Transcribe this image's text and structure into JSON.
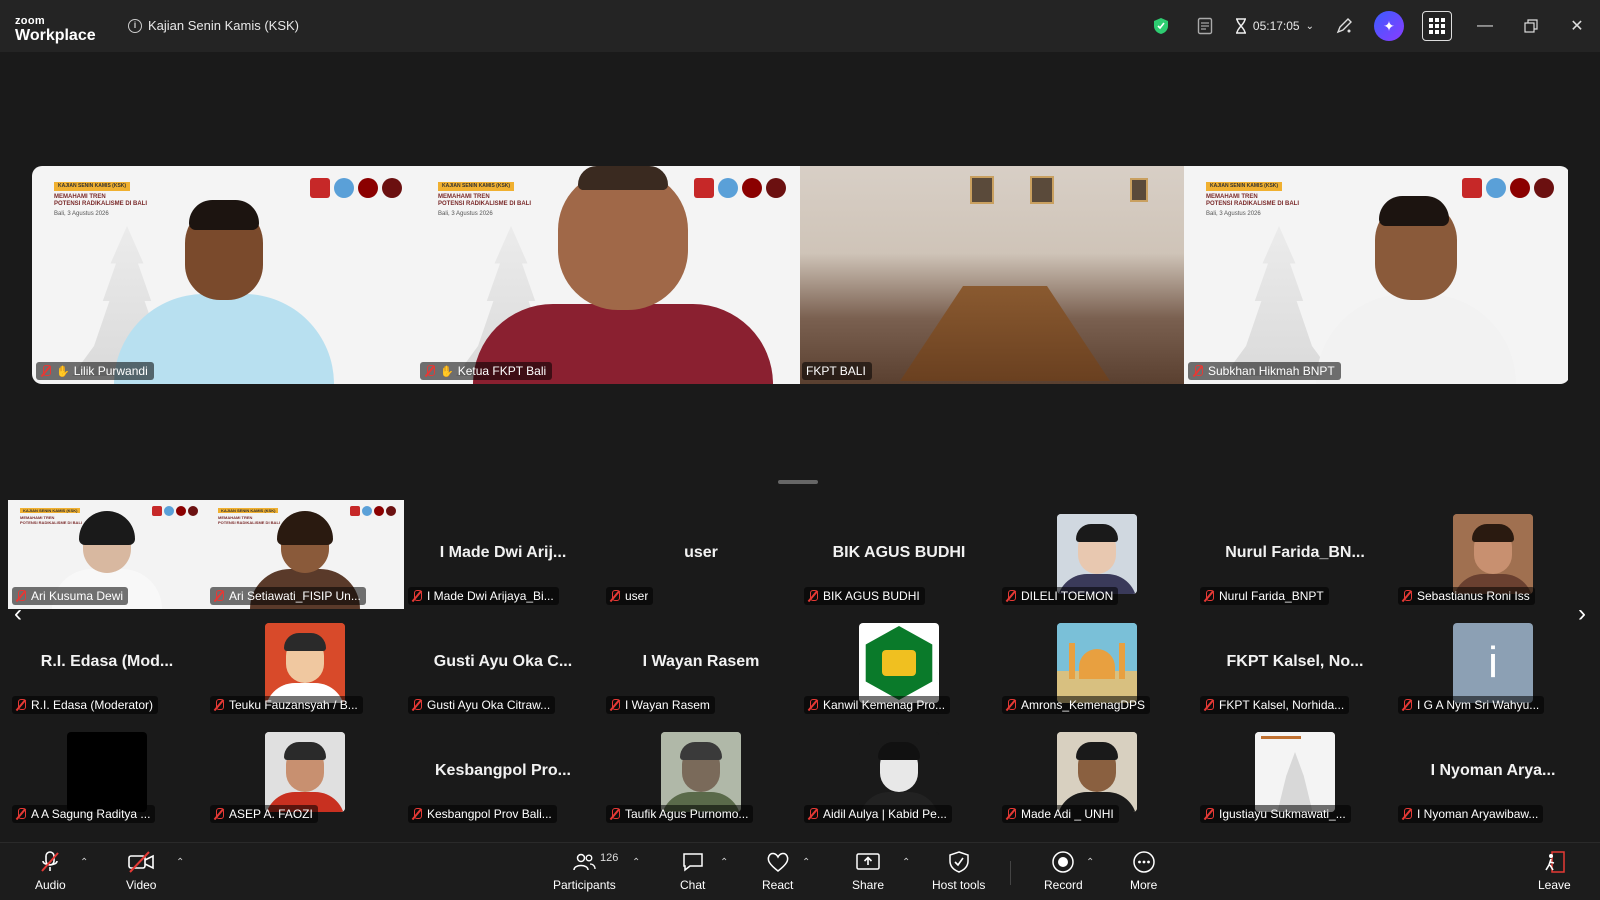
{
  "app": {
    "logo_line1": "zoom",
    "logo_line2": "Workplace",
    "meeting_title": "Kajian Senin Kamis (KSK)",
    "timer": "05:17:05"
  },
  "slide": {
    "tag": "KAJIAN SENIN KAMIS (KSK)",
    "title_line1": "MEMAHAMI TREN",
    "title_line2": "POTENSI RADIKALISME DI BALI",
    "date": "Bali, 3 Agustus 2026"
  },
  "speakers": [
    {
      "name": "Lilik Purwandi"
    },
    {
      "name": "Ketua FKPT Bali"
    },
    {
      "name": "FKPT BALI"
    },
    {
      "name": "Subkhan Hikmah BNPT"
    }
  ],
  "gallery": {
    "row1": [
      {
        "label": "Ari Kusuma Dewi",
        "big": ""
      },
      {
        "label": "Ari Setiawati_FISIP Un...",
        "big": ""
      },
      {
        "label": "I Made Dwi Arijaya_Bi...",
        "big": "I Made Dwi Arij..."
      },
      {
        "label": "user",
        "big": "user"
      },
      {
        "label": "BIK AGUS BUDHI",
        "big": "BIK AGUS BUDHI"
      },
      {
        "label": "DILELI TOEMON",
        "big": ""
      },
      {
        "label": "Nurul Farida_BNPT",
        "big": "Nurul Farida_BN..."
      },
      {
        "label": "Sebastianus Roni Iss",
        "big": ""
      }
    ],
    "row2": [
      {
        "label": "R.I. Edasa (Moderator)",
        "big": "R.I. Edasa (Mod..."
      },
      {
        "label": "Teuku Fauzansyah / B...",
        "big": ""
      },
      {
        "label": "Gusti Ayu Oka Citraw...",
        "big": "Gusti Ayu Oka C..."
      },
      {
        "label": "I Wayan Rasem",
        "big": "I Wayan Rasem"
      },
      {
        "label": "Kanwil Kemenag Pro...",
        "big": ""
      },
      {
        "label": "Amrons_KemenagDPS",
        "big": ""
      },
      {
        "label": "FKPT Kalsel, Norhida...",
        "big": "FKPT Kalsel, No..."
      },
      {
        "label": "I G A Nym Sri Wahyu...",
        "big": ""
      }
    ],
    "row3": [
      {
        "label": "A A Sagung Raditya ...",
        "big": ""
      },
      {
        "label": "ASEP A. FAOZI",
        "big": ""
      },
      {
        "label": "Kesbangpol Prov Bali...",
        "big": "Kesbangpol Pro..."
      },
      {
        "label": "Taufik Agus Purnomo...",
        "big": ""
      },
      {
        "label": "Aidil Aulya | Kabid Pe...",
        "big": ""
      },
      {
        "label": "Made Adi _ UNHI",
        "big": ""
      },
      {
        "label": "Igustiayu Sukmawati_...",
        "big": ""
      },
      {
        "label": "I Nyoman Aryawibaw...",
        "big": "I Nyoman Arya..."
      }
    ],
    "avatar_letter": "i"
  },
  "toolbar": {
    "audio": "Audio",
    "video": "Video",
    "participants": "Participants",
    "participants_count": "126",
    "chat": "Chat",
    "react": "React",
    "share": "Share",
    "host_tools": "Host tools",
    "record": "Record",
    "more": "More",
    "leave": "Leave"
  },
  "colors": {
    "active_speaker": "#2ecc71",
    "mic_off": "#e53935",
    "shield": "#2ecc71"
  }
}
